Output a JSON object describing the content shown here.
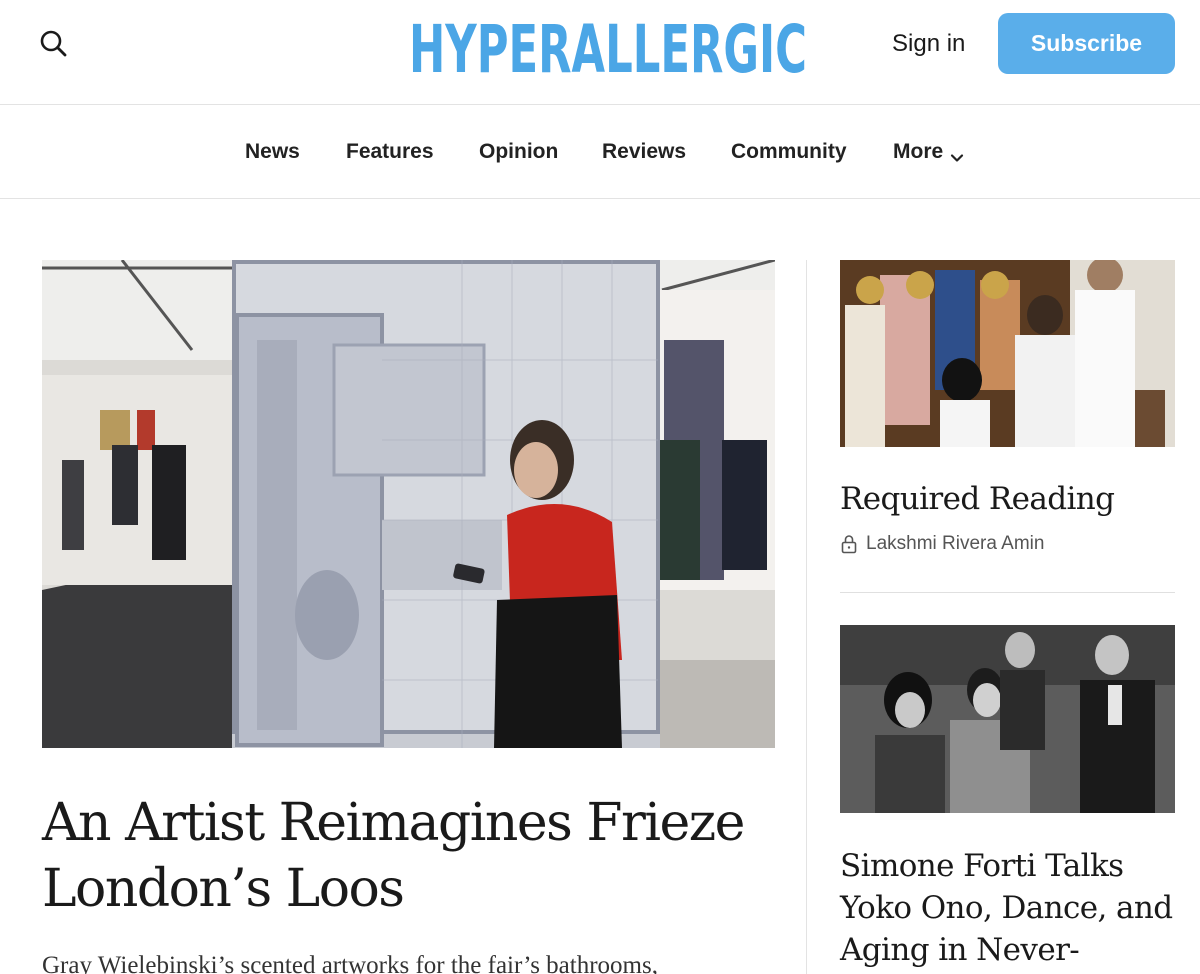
{
  "header": {
    "logo_text": "HYPERALLERGIC",
    "sign_in": "Sign in",
    "subscribe": "Subscribe",
    "search_icon": "search-icon"
  },
  "nav": {
    "items": [
      "News",
      "Features",
      "Opinion",
      "Reviews",
      "Community"
    ],
    "more": "More"
  },
  "hero": {
    "title_line1": "An Artist Reimagines Frieze",
    "title_line2": "London’s Loos",
    "dek": "Gray Wielebinski’s scented artworks for the fair’s bathrooms,"
  },
  "sidebar": {
    "articles": [
      {
        "title": "Required Reading",
        "author": "Lakshmi Rivera Amin",
        "locked": true
      },
      {
        "title_line1": "Simone Forti Talks",
        "title_line2": "Yoko Ono, Dance, and",
        "title_line3": "Aging in Never-"
      }
    ]
  },
  "colors": {
    "brand": "#4ba6e6",
    "subscribe_bg": "#5aaeea",
    "text": "#1a1a1a"
  }
}
